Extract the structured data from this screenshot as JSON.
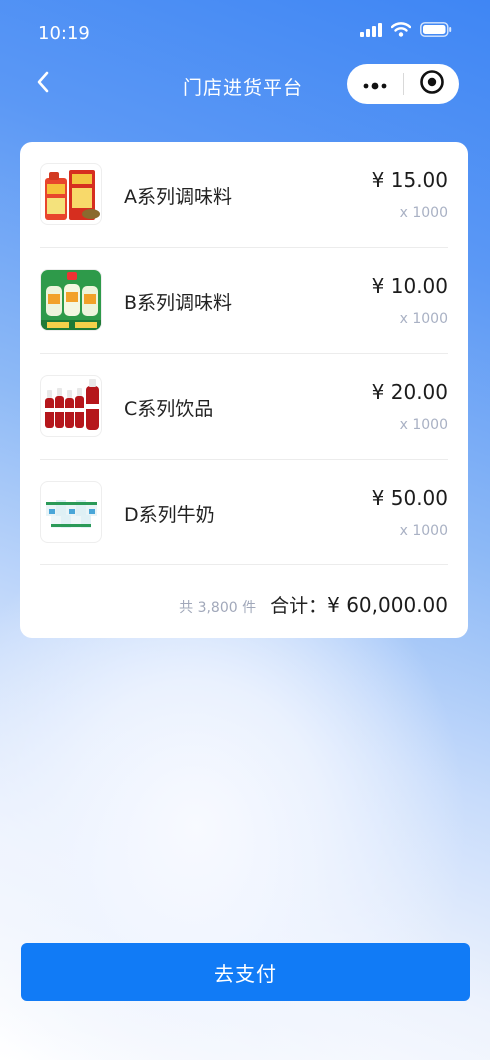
{
  "status_bar": {
    "time": "10:19"
  },
  "nav": {
    "title": "门店进货平台"
  },
  "order": {
    "items": [
      {
        "name": "A系列调味料",
        "price": "¥ 15.00",
        "qty": "x 1000",
        "icon": "seasoning-bottles-thumbnail"
      },
      {
        "name": "B系列调味料",
        "price": "¥ 10.00",
        "qty": "x 1000",
        "icon": "seasoning-jars-thumbnail"
      },
      {
        "name": "C系列饮品",
        "price": "¥ 20.00",
        "qty": "x 1000",
        "icon": "cola-bottles-thumbnail"
      },
      {
        "name": "D系列牛奶",
        "price": "¥ 50.00",
        "qty": "x 1000",
        "icon": "milk-cartons-thumbnail"
      }
    ],
    "total_count": "共 3,800 件",
    "total_label": "合计：",
    "total_value": "¥ 60,000.00"
  },
  "pay_button": {
    "label": "去支付"
  },
  "colors": {
    "primary": "#117bf6",
    "header_gradient": "#3f86f4",
    "qty_text": "#a9b1c4"
  }
}
